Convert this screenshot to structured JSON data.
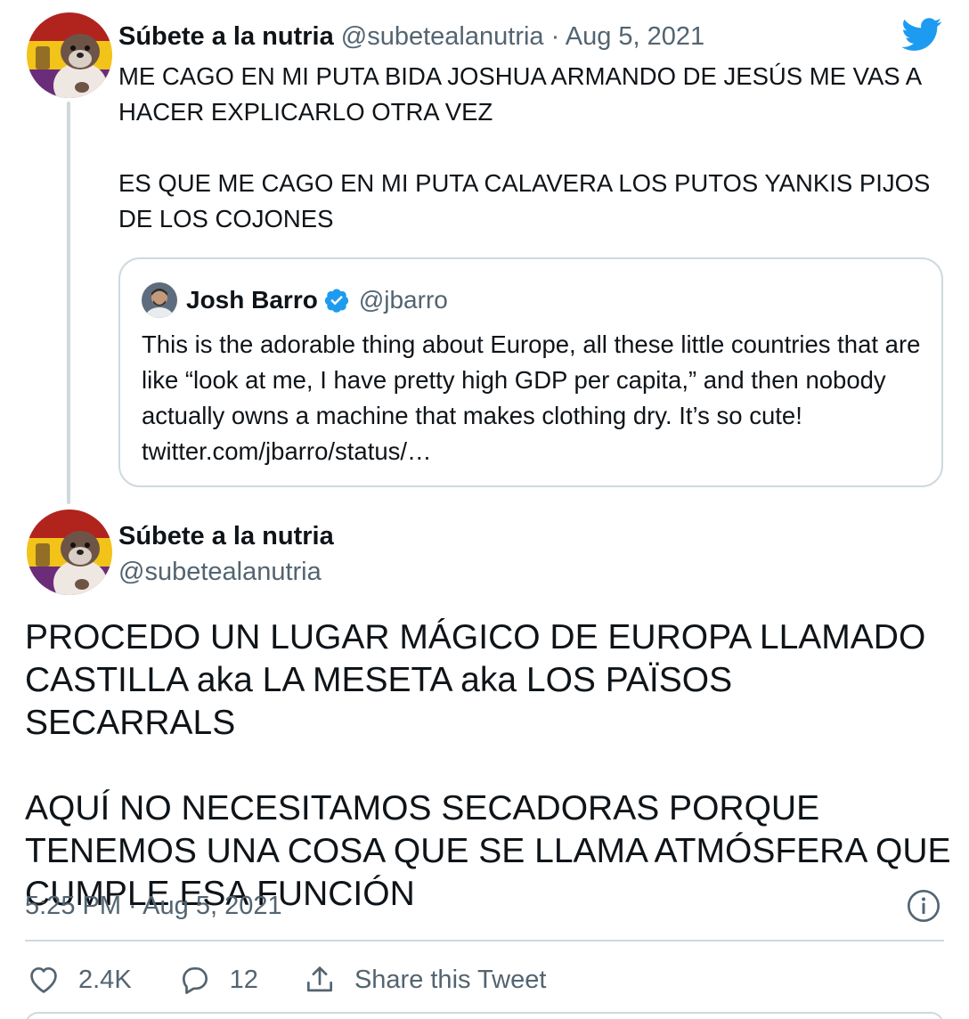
{
  "tweet1": {
    "author_name": "Súbete a la nutria",
    "author_handle": "@subetealanutria",
    "separator": "·",
    "date": "Aug 5, 2021",
    "paragraphs": [
      "ME CAGO EN MI PUTA BIDA JOSHUA ARMANDO DE JESÚS ME VAS A HACER EXPLICARLO OTRA VEZ",
      "ES QUE ME CAGO EN MI PUTA CALAVERA LOS PUTOS YANKIS PIJOS DE LOS COJONES"
    ],
    "avatar_icon": "otter-avatar"
  },
  "quoted": {
    "author_name": "Josh Barro",
    "verified_icon": "verified-badge-icon",
    "author_handle": "@jbarro",
    "text": "This is the adorable thing about Europe, all these little countries that are like “look at me, I have pretty high GDP per capita,” and then nobody actually owns a machine that makes clothing dry. It’s so cute! twitter.com/jbarro/status/…"
  },
  "tweet2": {
    "author_name": "Súbete a la nutria",
    "author_handle": "@subetealanutria",
    "paragraphs": [
      "PROCEDO UN LUGAR MÁGICO DE EUROPA LLAMADO CASTILLA aka LA MESETA aka LOS PAÏSOS SECARRALS",
      "AQUÍ NO NECESITAMOS SECADORAS PORQUE TENEMOS UNA COSA QUE SE LLAMA ATMÓSFERA QUE CUMPLE ESA FUNCIÓN"
    ],
    "timestamp": "5:25 PM · Aug 5, 2021"
  },
  "actions": {
    "likes": "2.4K",
    "replies": "12",
    "share_label": "Share this Tweet"
  },
  "colors": {
    "text": "#0f1419",
    "muted": "#536471",
    "border": "#cfd9de",
    "brand": "#1d9bf0"
  }
}
